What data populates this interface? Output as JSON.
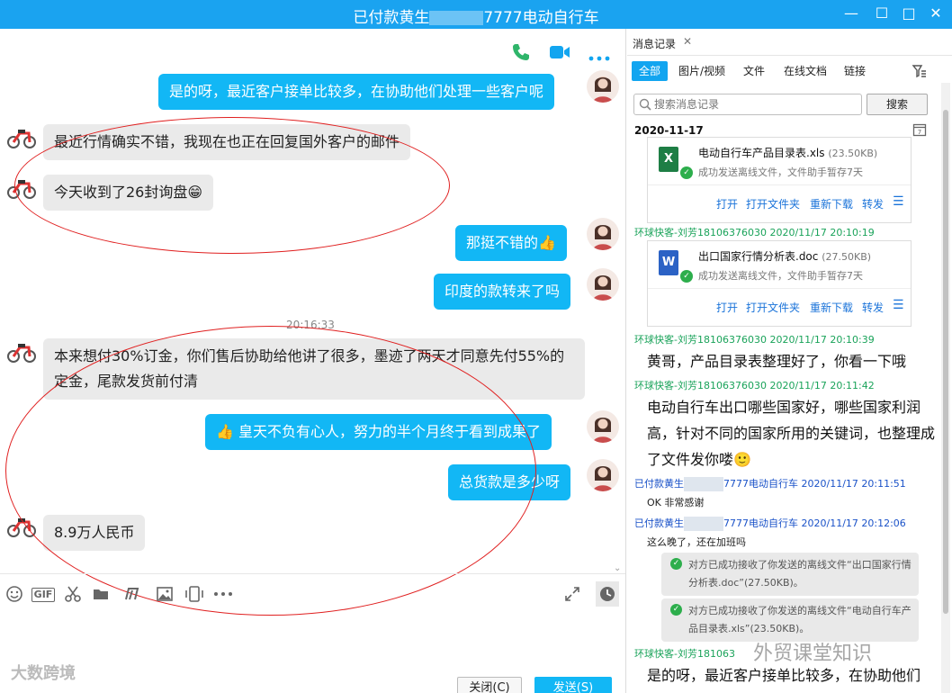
{
  "window": {
    "title_prefix": "已付款黄生",
    "title_suffix": "7777电动自行车",
    "minimize": "—",
    "restore": "☐",
    "maximize": "□",
    "close": "✕"
  },
  "chat": {
    "top_icons": [
      "phone-icon",
      "video-icon",
      "more-icon"
    ],
    "messages": [
      {
        "from": "me",
        "text": "是的呀，最近客户接单比较多，在协助他们处理一些客户呢"
      },
      {
        "from": "them",
        "text": "最近行情确实不错，我现在也正在回复国外客户的邮件"
      },
      {
        "from": "them",
        "text": "今天收到了26封询盘😁"
      },
      {
        "from": "me",
        "text": "那挺不错的👍"
      },
      {
        "from": "me",
        "text": "印度的款转来了吗"
      },
      {
        "from": "them",
        "text": "本来想付30%订金，你们售后协助给他讲了很多，墨迹了两天才同意先付55%的定金，尾款发货前付清"
      },
      {
        "from": "me",
        "text": "👍 皇天不负有心人，努力的半个月终于看到成果了"
      },
      {
        "from": "me",
        "text": "总货款是多少呀"
      },
      {
        "from": "them",
        "text": "8.9万人民币"
      }
    ],
    "timestamp": "20:16:33",
    "toolbar_icons": [
      "emoji-icon",
      "gif-icon",
      "scissors-icon",
      "folder-icon",
      "music-icon",
      "image-icon",
      "shake-icon",
      "more-icon",
      "expand-icon",
      "history-icon"
    ],
    "gif_label": "GIF",
    "close_button": "关闭(C)",
    "send_button": "发送(S)",
    "watermark": "大数跨境"
  },
  "history": {
    "tab_label": "消息记录",
    "filters": [
      "全部",
      "图片/视频",
      "文件",
      "在线文档",
      "链接"
    ],
    "search_placeholder": "搜索消息记录",
    "search_button": "搜索",
    "date": "2020-11-17",
    "files": [
      {
        "name": "电动自行车产品目录表.xls",
        "size": "(23.50KB)",
        "status": "成功发送离线文件，文件助手暂存7天",
        "type": "xls",
        "color": "#1e7e45"
      },
      {
        "name": "出口国家行情分析表.doc",
        "size": "(27.50KB)",
        "status": "成功发送离线文件，文件助手暂存7天",
        "type": "doc",
        "color": "#2b62c5"
      }
    ],
    "file_actions": [
      "打开",
      "打开文件夹",
      "重新下载",
      "转发"
    ],
    "sender_me": "环球快客-刘芳18106376030",
    "sender_me_short": "环球快客-刘芳181063",
    "sender_them_prefix": "已付款黄生",
    "sender_them_suffix": "7777电动自行车",
    "times": [
      "2020/11/17 20:10:19",
      "2020/11/17 20:10:39",
      "2020/11/17 20:11:42",
      "2020/11/17 20:11:51",
      "2020/11/17 20:12:06"
    ],
    "msg_catalog": "黄哥，产品目录表整理好了，你看一下哦",
    "msg_countries": "电动自行车出口哪些国家好，哪些国家利润高，针对不同的国家所用的关键词，也整理成了文件发你喽🙂",
    "msg_ok": "OK 非常感谢",
    "msg_late": "这么晚了，还在加班吗",
    "sys_1": "对方已成功接收了你发送的离线文件“出口国家行情分析表.doc”(27.50KB)。",
    "sys_2": "对方已成功接收了你发送的离线文件“电动自行车产品目录表.xls”(23.50KB)。",
    "msg_last": "是的呀，最近客户接单比较多，在协助他们",
    "watermark": "外贸课堂知识"
  },
  "colors": {
    "accent": "#12b7f5",
    "title_bar": "#1aa3f0",
    "annotation": "#e02020"
  }
}
